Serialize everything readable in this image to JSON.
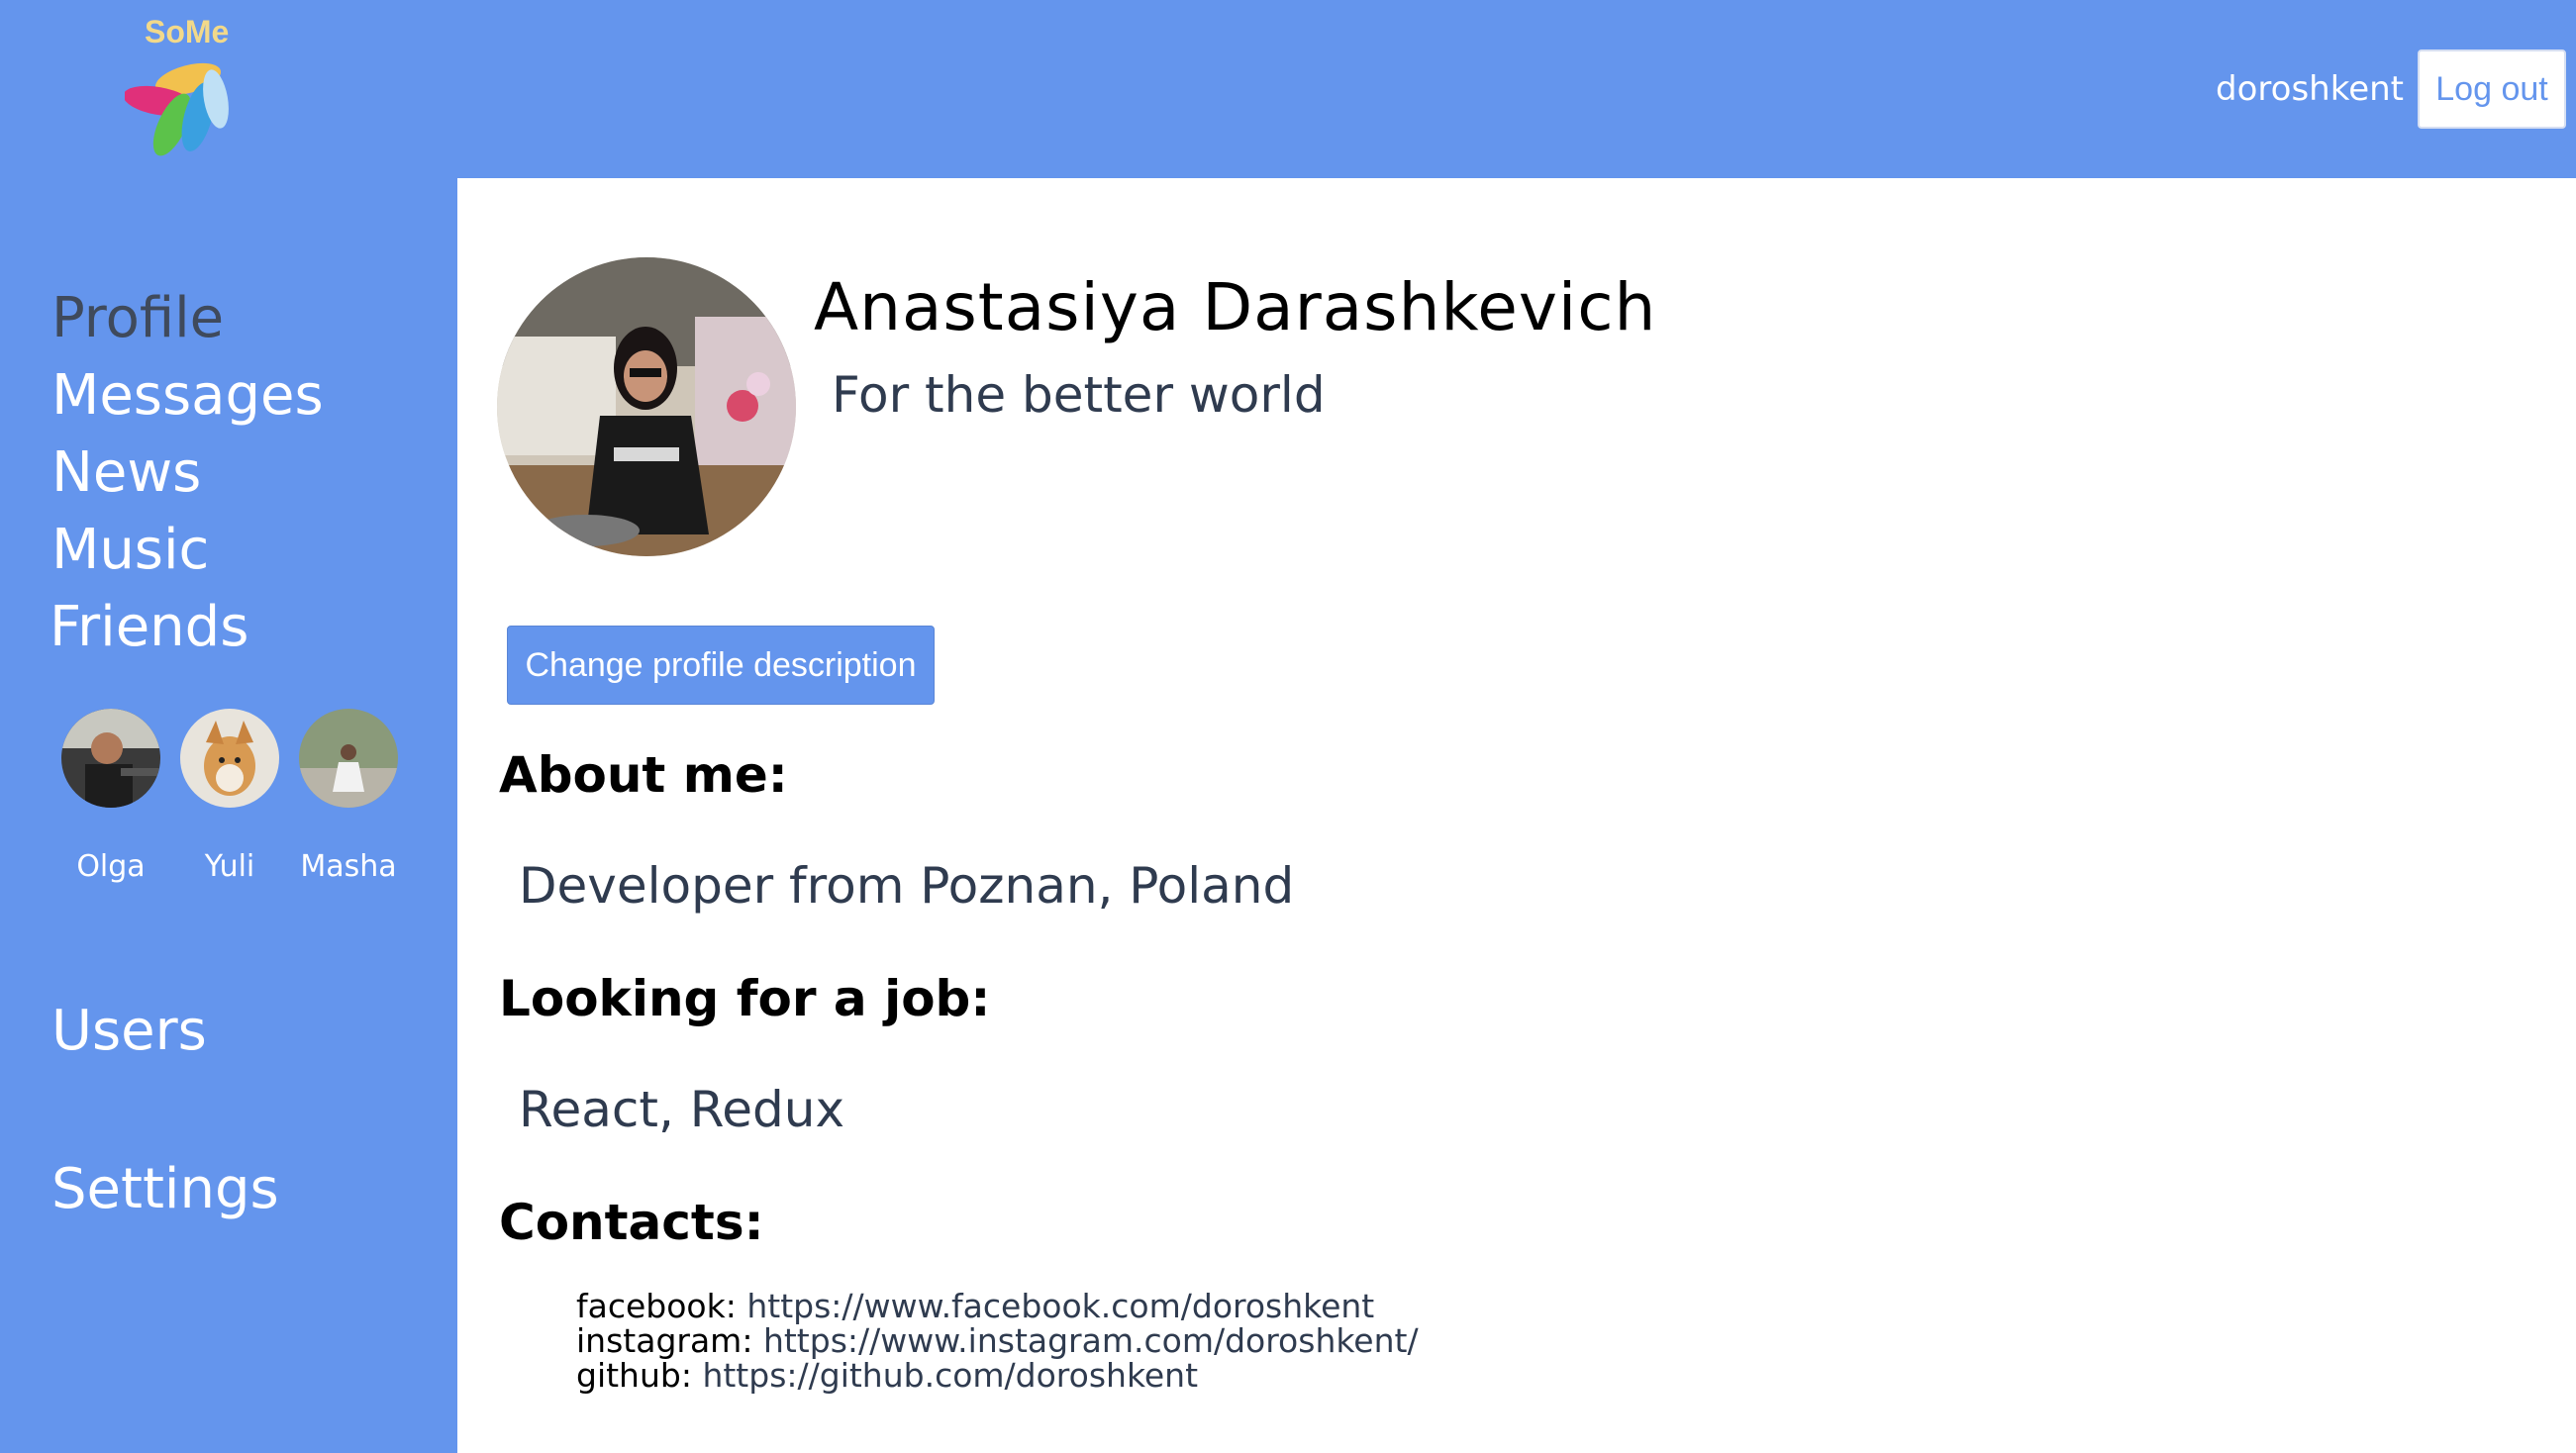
{
  "header": {
    "logo_text": "SoMe",
    "login_name": "doroshkent",
    "logout_label": "Log out"
  },
  "sidebar": {
    "nav": [
      {
        "label": "Profile"
      },
      {
        "label": "Messages"
      },
      {
        "label": "News"
      },
      {
        "label": "Music"
      },
      {
        "label": "Friends"
      }
    ],
    "friends": [
      {
        "name": "Olga"
      },
      {
        "name": "Yuli"
      },
      {
        "name": "Masha"
      }
    ],
    "users_label": "Users",
    "settings_label": "Settings"
  },
  "profile": {
    "full_name": "Anastasiya Darashkevich",
    "status": "For the better world",
    "change_button": "Change profile description",
    "about_title": "About me:",
    "about_value": "Developer from Poznan, Poland",
    "job_title": "Looking for a job:",
    "job_value": "React, Redux",
    "contacts_title": "Contacts:",
    "contacts": [
      {
        "label": "facebook:",
        "url": "https://www.facebook.com/doroshkent"
      },
      {
        "label": "instagram:",
        "url": "https://www.instagram.com/doroshkent/"
      },
      {
        "label": "github:",
        "url": "https://github.com/doroshkent"
      }
    ]
  },
  "colors": {
    "brand_blue": "#6495ed",
    "white": "#ffffff",
    "text_dark": "#2f3b4f"
  }
}
